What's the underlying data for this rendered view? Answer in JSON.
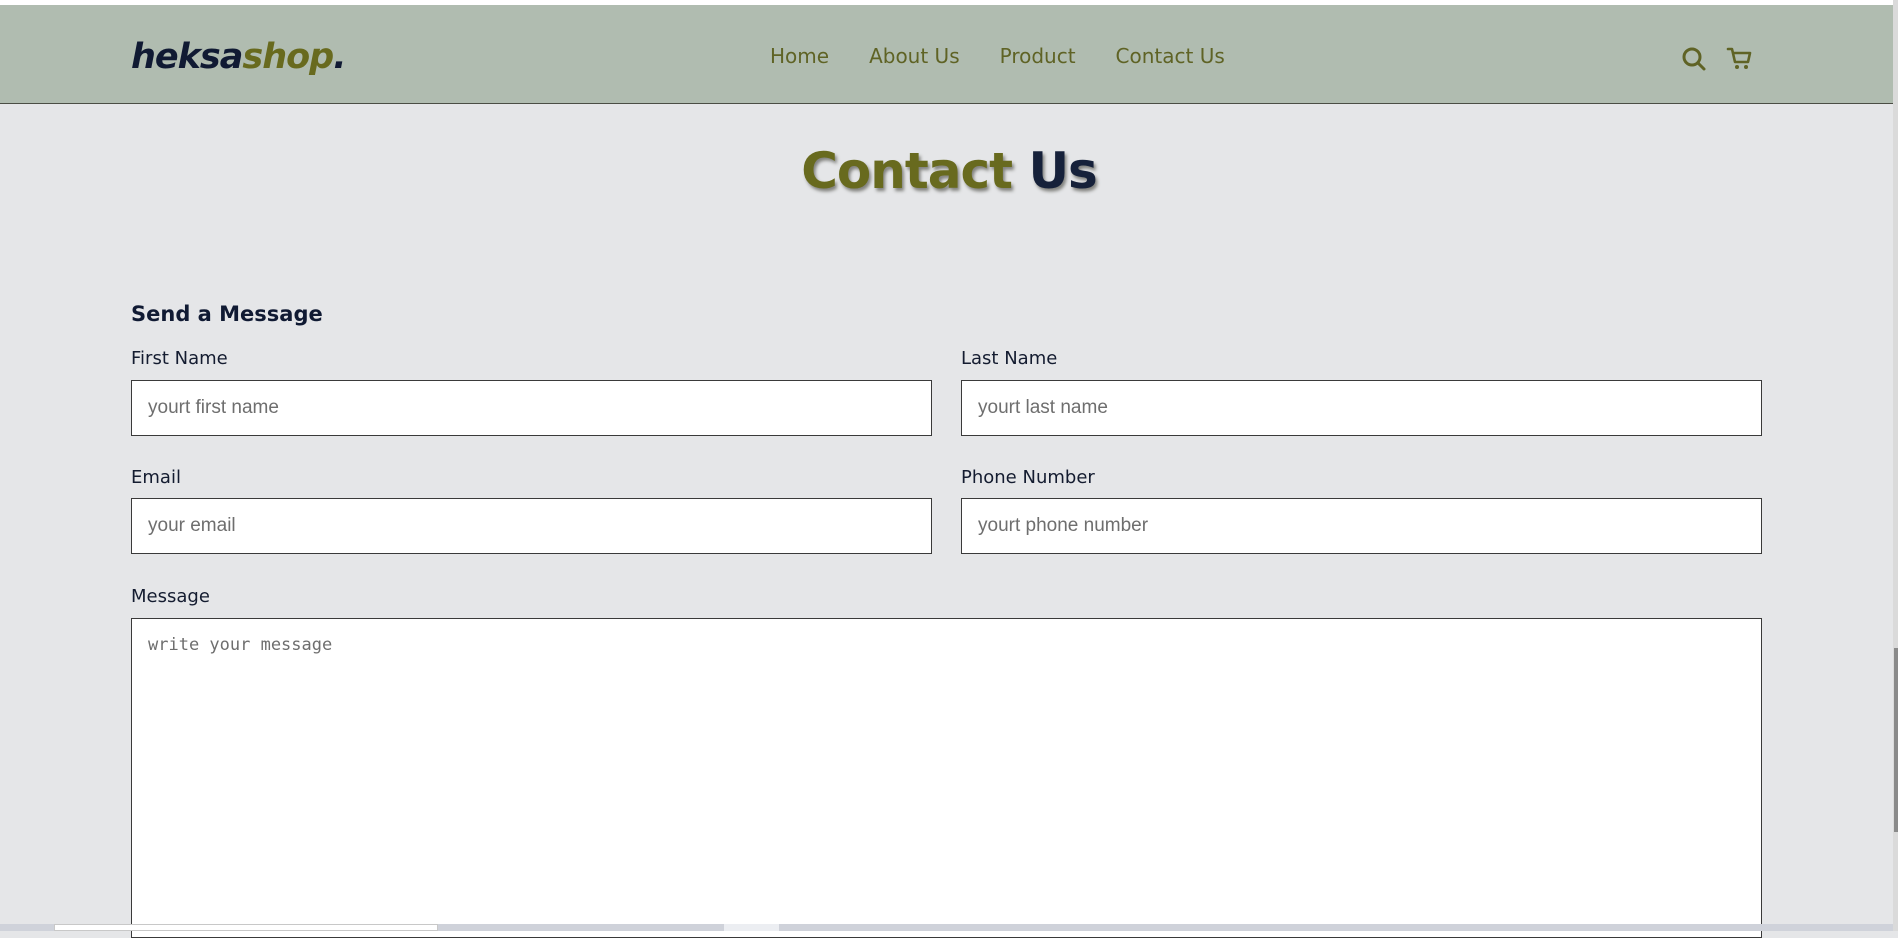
{
  "header": {
    "logo": {
      "part1": "heksa",
      "part2": "shop",
      "part3": "."
    },
    "nav": [
      {
        "label": "Home"
      },
      {
        "label": "About Us"
      },
      {
        "label": "Product"
      },
      {
        "label": "Contact Us"
      }
    ],
    "icons": {
      "search": "search-icon",
      "cart": "cart-icon"
    }
  },
  "page": {
    "title_part1": "Contact",
    "title_part2": "Us"
  },
  "form": {
    "section_title": "Send a Message",
    "first_name": {
      "label": "First Name",
      "placeholder": "yourt first name"
    },
    "last_name": {
      "label": "Last Name",
      "placeholder": "yourt last name"
    },
    "email": {
      "label": "Email",
      "placeholder": "your email"
    },
    "phone": {
      "label": "Phone Number",
      "placeholder": "yourt phone number"
    },
    "message": {
      "label": "Message",
      "placeholder": "write your message"
    }
  },
  "colors": {
    "navbar_bg": "#b0bcb0",
    "page_bg": "#e5e6e8",
    "accent_olive": "#686a1e",
    "navy": "#101a33"
  }
}
